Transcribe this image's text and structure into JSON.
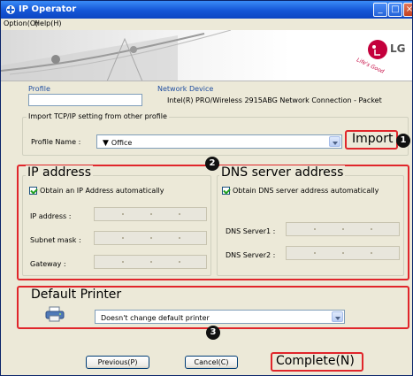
{
  "window": {
    "title": "IP Operator"
  },
  "menu": [
    {
      "label": "Option(O)"
    },
    {
      "label": "Help(H)"
    }
  ],
  "header": {
    "logo_text": "LG",
    "slogan": "Life's Good"
  },
  "profile": {
    "label": "Profile",
    "value": ""
  },
  "network_device": {
    "label": "Network Device",
    "value": "Intel(R) PRO/Wireless 2915ABG Network Connection - Packet"
  },
  "import_group": {
    "label": "Import TCP/IP setting from other profile",
    "profile_name_label": "Profile Name :",
    "profile_name_value": "Office",
    "import_button": "Import"
  },
  "ip_group": {
    "label": "IP address",
    "obtain_auto": "Obtain an IP Address automatically",
    "checked": true,
    "fields": [
      {
        "label": "IP address :"
      },
      {
        "label": "Subnet mask :"
      },
      {
        "label": "Gateway :"
      }
    ]
  },
  "dns_group": {
    "label": "DNS server address",
    "obtain_auto": "Obtain DNS server address automatically",
    "checked": true,
    "fields": [
      {
        "label": "DNS Server1 :"
      },
      {
        "label": "DNS Server2 :"
      }
    ]
  },
  "printer_group": {
    "label": "Default Printer",
    "selected": "Doesn't change default printer"
  },
  "badges": {
    "b1": "1",
    "b2": "2",
    "b3": "3"
  },
  "buttons": {
    "previous": "Previous(P)",
    "cancel": "Cancel(C)",
    "complete": "Complete(N)"
  },
  "colors": {
    "titlebar": "#1456d6",
    "highlight": "#e0262b",
    "lg_red": "#c4003c"
  },
  "icons": [
    "app-icon",
    "minimize-icon",
    "maximize-icon",
    "close-icon",
    "printer-icon",
    "dropdown-arrow-icon",
    "network-icon"
  ]
}
